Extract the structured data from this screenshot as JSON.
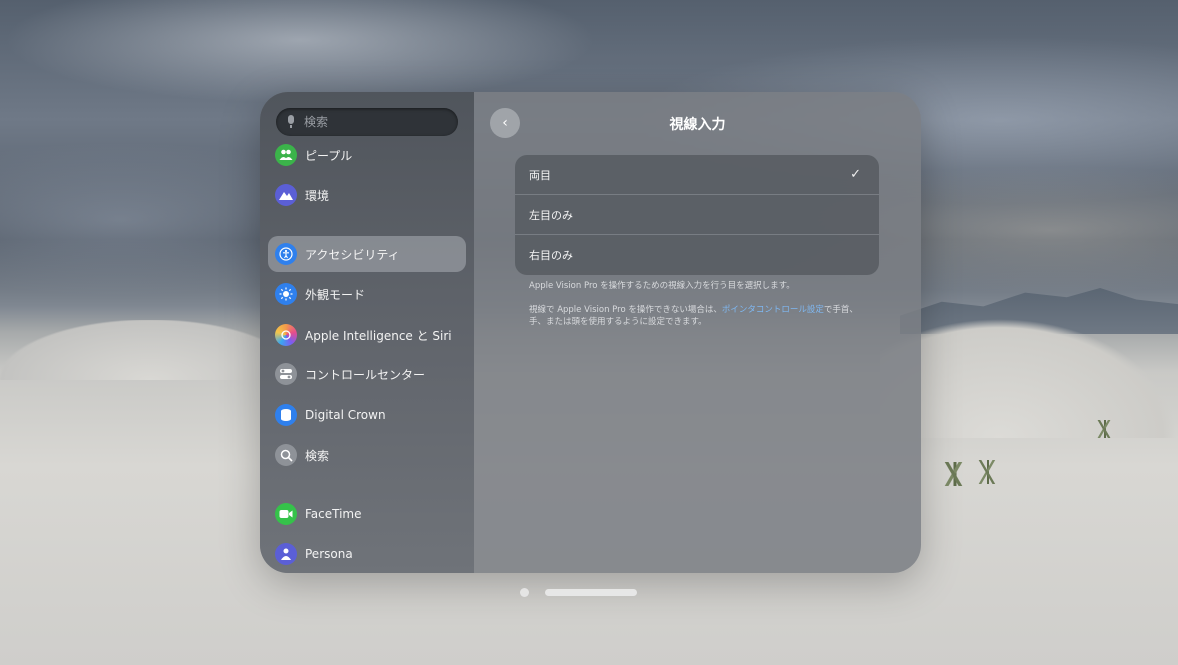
{
  "search": {
    "placeholder": "検索"
  },
  "sidebar": {
    "items": [
      {
        "label": "ピープル",
        "icon": "people-icon",
        "color": "#3bb34a"
      },
      {
        "label": "環境",
        "icon": "mountain-icon",
        "color": "#5b5fd6"
      },
      {
        "label": "アクセシビリティ",
        "icon": "accessibility-icon",
        "color": "#2f80ed",
        "selected": true
      },
      {
        "label": "外観モード",
        "icon": "sun-icon",
        "color": "#2f80ed"
      },
      {
        "label": "Apple Intelligence と Siri",
        "icon": "siri-icon",
        "color": "#c06fd6"
      },
      {
        "label": "コントロールセンター",
        "icon": "toggle-icon",
        "color": "#8e9298"
      },
      {
        "label": "Digital Crown",
        "icon": "crown-icon",
        "color": "#2f80ed"
      },
      {
        "label": "検索",
        "icon": "magnifier-icon",
        "color": "#8e9298"
      },
      {
        "label": "FaceTime",
        "icon": "video-icon",
        "color": "#35c24a"
      },
      {
        "label": "Persona",
        "icon": "persona-icon",
        "color": "#5b5fd6"
      }
    ]
  },
  "content": {
    "title": "視線入力",
    "options": [
      {
        "label": "両目",
        "checked": true
      },
      {
        "label": "左目のみ",
        "checked": false
      },
      {
        "label": "右目のみ",
        "checked": false
      }
    ],
    "note1": "Apple Vision Pro を操作するための視線入力を行う目を選択します。",
    "note2_pre": "視線で Apple Vision Pro を操作できない場合は、",
    "note2_link": "ポインタコントロール設定",
    "note2_post_line1": "で手首、",
    "note2_line2": "手、または頭を使用するように設定できます。"
  },
  "icons": {
    "back": "‹",
    "check": "✓"
  }
}
